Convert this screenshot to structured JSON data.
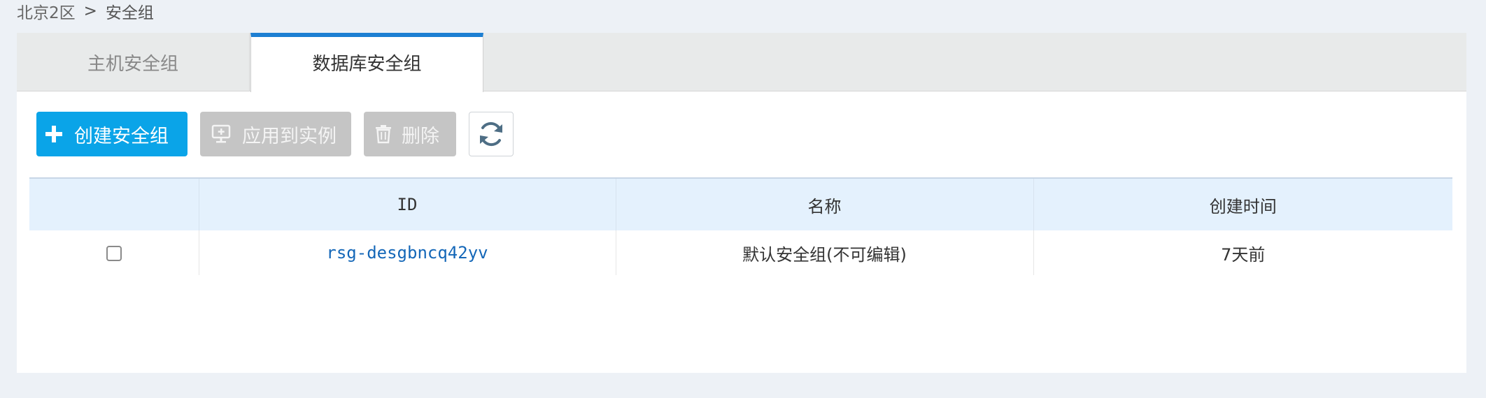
{
  "breadcrumb": {
    "region": "北京2区",
    "separator": ">",
    "current": "安全组"
  },
  "tabs": [
    {
      "label": "主机安全组",
      "active": false
    },
    {
      "label": "数据库安全组",
      "active": true
    }
  ],
  "toolbar": {
    "create_label": "创建安全组",
    "apply_label": "应用到实例",
    "delete_label": "删除",
    "refresh_icon": "refresh-icon"
  },
  "table": {
    "columns": [
      "",
      "ID",
      "名称",
      "创建时间"
    ],
    "rows": [
      {
        "checked": false,
        "id": "rsg-desgbncq42yv",
        "name": "默认安全组(不可编辑)",
        "created": "7天前"
      }
    ]
  },
  "colors": {
    "accent": "#0aa4e8",
    "tab_indicator": "#1d7fd2",
    "disabled": "#c5c5c5",
    "link": "#1467b8",
    "header_bg": "#e4f1fd"
  }
}
